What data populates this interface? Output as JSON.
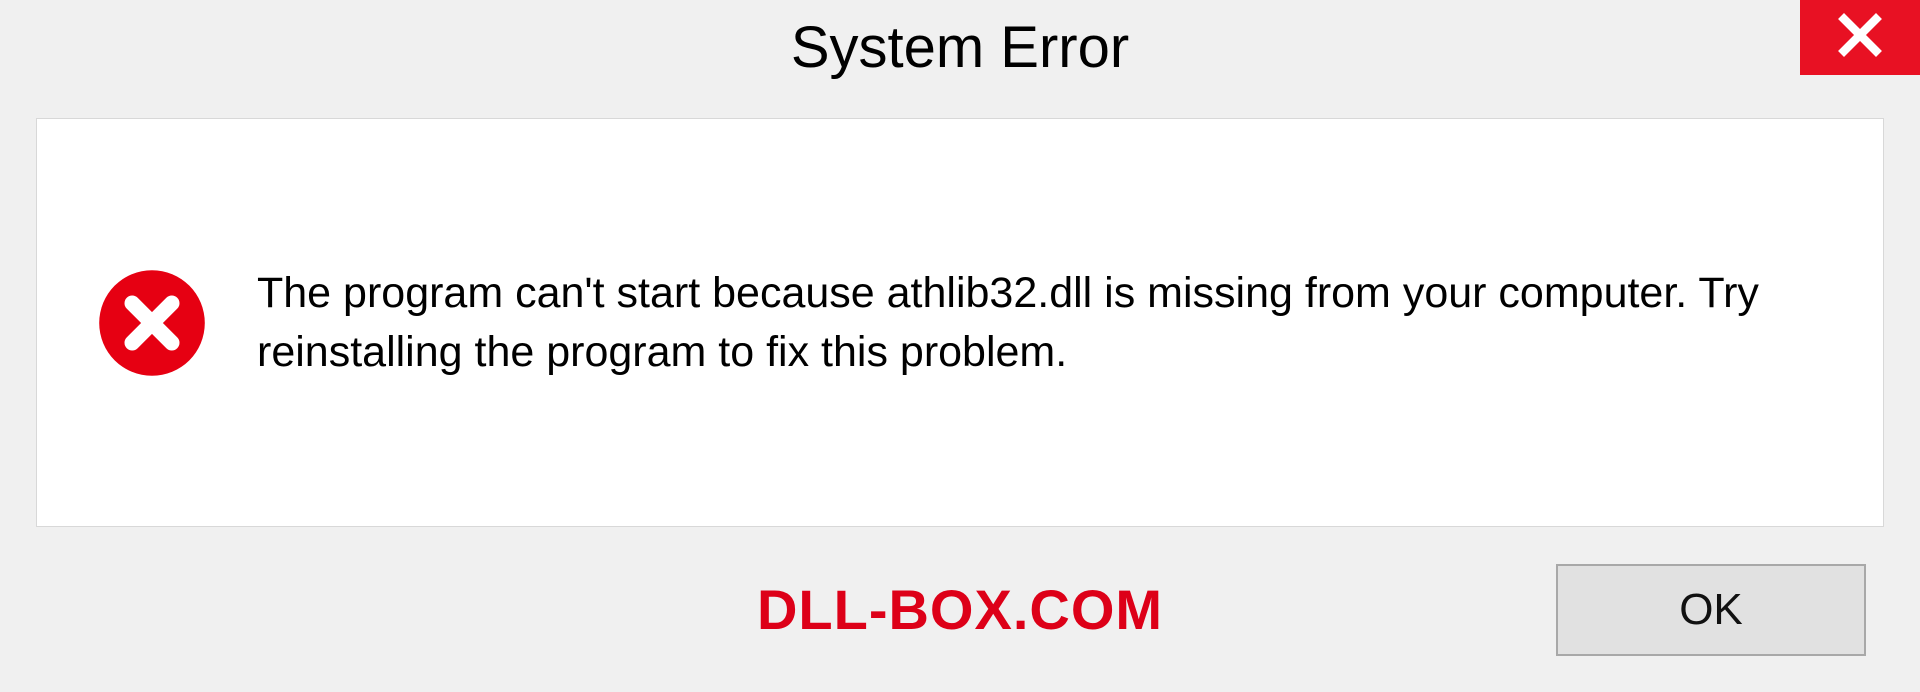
{
  "titlebar": {
    "title": "System Error"
  },
  "content": {
    "message": "The program can't start because athlib32.dll is missing from your computer. Try reinstalling the program to fix this problem."
  },
  "footer": {
    "watermark": "DLL-BOX.COM",
    "ok_label": "OK"
  },
  "colors": {
    "close_bg": "#e81123",
    "error_icon": "#e60012",
    "watermark": "#dd0018"
  }
}
